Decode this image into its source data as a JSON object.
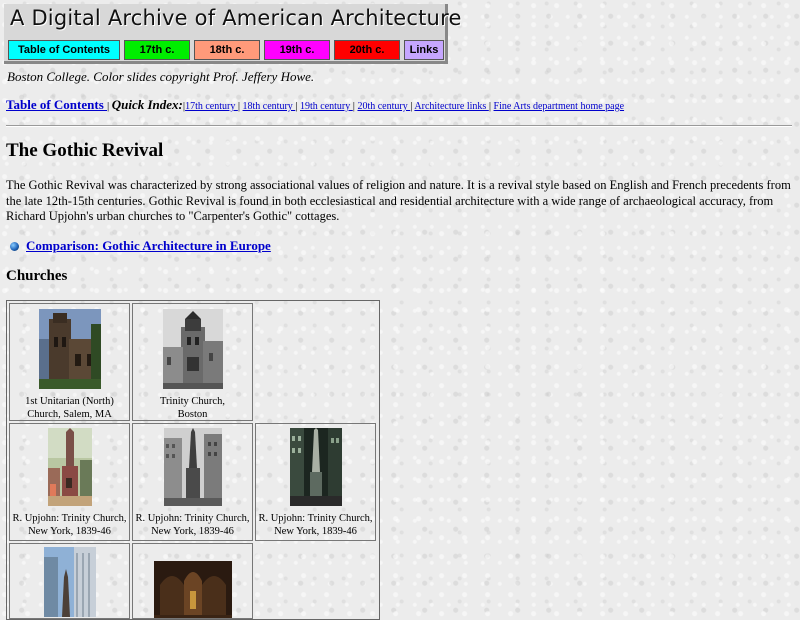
{
  "banner": {
    "title": "A Digital Archive of American Architecture",
    "buttons": [
      {
        "label": "Table of Contents",
        "color": "#00ffff"
      },
      {
        "label": "17th c.",
        "color": "#00ee00"
      },
      {
        "label": "18th c.",
        "color": "#ff9a7a"
      },
      {
        "label": "19th c.",
        "color": "#ff00ff"
      },
      {
        "label": "20th c.",
        "color": "#ff0000"
      },
      {
        "label": "Links",
        "color": "#c6a6ff"
      }
    ]
  },
  "credits": "Boston College. Color slides copyright Prof. Jeffery Howe.",
  "quick_index": {
    "toc_link": "Table of Contents ",
    "label": "Quick Index:",
    "links": [
      "17th century ",
      "18th century ",
      "19th century ",
      "20th century ",
      "Architecture links ",
      "Fine Arts department home page"
    ]
  },
  "page_title": "The Gothic Revival",
  "intro": "The Gothic Revival was characterized by strong associational values of religion and nature. It is a revival style based on English and French precedents from the late 12th-15th centuries. Gothic Revival is found in both ecclesiastical and residential architecture with a wide range of archaeological accuracy, from Richard Upjohn's urban churches to \"Carpenter's Gothic\" cottages.",
  "comparison_link": "Comparison: Gothic Architecture in Europe",
  "section_churches": "Churches",
  "churches": [
    {
      "caption_line1": "1st Unitarian (North)",
      "caption_line2": "Church, Salem, MA"
    },
    {
      "caption_line1": "Trinity Church,",
      "caption_line2": "Boston"
    },
    {
      "caption_line1": "R. Upjohn: Trinity Church,",
      "caption_line2": "New York, 1839-46"
    },
    {
      "caption_line1": "R. Upjohn: Trinity Church,",
      "caption_line2": "New York, 1839-46"
    },
    {
      "caption_line1": "R. Upjohn: Trinity Church,",
      "caption_line2": "New York, 1839-46"
    }
  ]
}
